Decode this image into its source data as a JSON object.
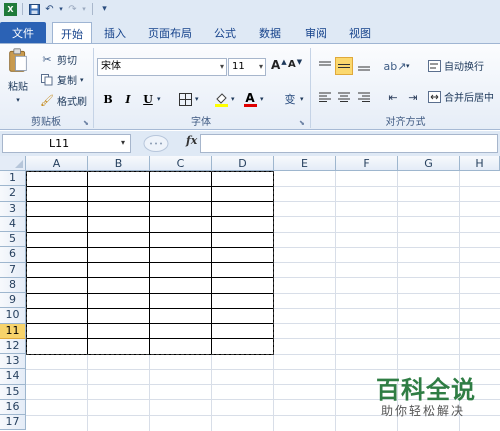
{
  "quick_access": {
    "save": "save-icon",
    "undo": "undo-icon",
    "redo": "redo-icon",
    "customize": "▾"
  },
  "tabs": [
    {
      "label": "文件"
    },
    {
      "label": "开始"
    },
    {
      "label": "插入"
    },
    {
      "label": "页面布局"
    },
    {
      "label": "公式"
    },
    {
      "label": "数据"
    },
    {
      "label": "审阅"
    },
    {
      "label": "视图"
    }
  ],
  "clipboard": {
    "paste": "粘贴",
    "cut": "剪切",
    "copy": "复制",
    "format_painter": "格式刷",
    "group": "剪贴板"
  },
  "font": {
    "name": "宋体",
    "size": "11",
    "grow": "A",
    "shrink": "A",
    "bold": "B",
    "italic": "I",
    "underline": "U",
    "color_letter": "A",
    "phonetic": "变",
    "group": "字体"
  },
  "alignment": {
    "wrap_text": "自动换行",
    "merge_center": "合并后居中",
    "group": "对齐方式"
  },
  "formula_bar": {
    "name_box": "L11",
    "fx": "fx",
    "value": ""
  },
  "columns": [
    "A",
    "B",
    "C",
    "D",
    "E",
    "F",
    "G",
    "H"
  ],
  "rows": [
    "1",
    "2",
    "3",
    "4",
    "5",
    "6",
    "7",
    "8",
    "9",
    "10",
    "11",
    "12",
    "13",
    "14",
    "15",
    "16",
    "17"
  ],
  "selected_row": "11",
  "watermark": {
    "main": "百科全说",
    "sub": "助你轻松解决"
  },
  "colors": {
    "file_tab": "#2b62b5",
    "ribbon": "#dfe9f5",
    "active_align": "#fbd86e",
    "selected_header": "#f7d36b",
    "watermark": "#2f7d44"
  }
}
